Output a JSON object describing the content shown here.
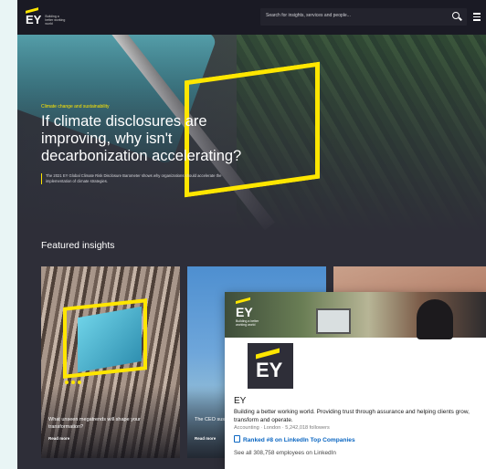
{
  "site": {
    "logo_text": "EY",
    "logo_tagline": "Building a better working world",
    "search_placeholder": "Search for insights, services and people...",
    "hero": {
      "kicker": "Climate change and sustainability",
      "headline": "If climate disclosures are improving, why isn't decarbonization accelerating?",
      "description": "The 2021 EY Global Climate Risk Disclosure Barometer shows why organizations should accelerate the implementation of climate strategies."
    },
    "featured_title": "Featured insights",
    "cards": [
      {
        "title": "What unseen megatrends will shape your transformation?",
        "cta": "Read more"
      },
      {
        "title": "The CEO sustainab",
        "cta": "Read more"
      },
      {
        "title": "",
        "cta": ""
      }
    ]
  },
  "linkedin": {
    "banner_logo": "EY",
    "banner_tagline": "Building a better working world",
    "profile_logo": "EY",
    "name": "EY",
    "tagline": "Building a better working world. Providing trust through assurance and helping clients grow, transform and operate.",
    "meta": "Accounting · London · 5,242,018 followers",
    "rank": "Ranked #8 on LinkedIn Top Companies",
    "employees": "See all 308,758 employees on LinkedIn"
  },
  "colors": {
    "accent": "#ffe600",
    "dark": "#2e2e38",
    "link": "#0a66c2"
  }
}
